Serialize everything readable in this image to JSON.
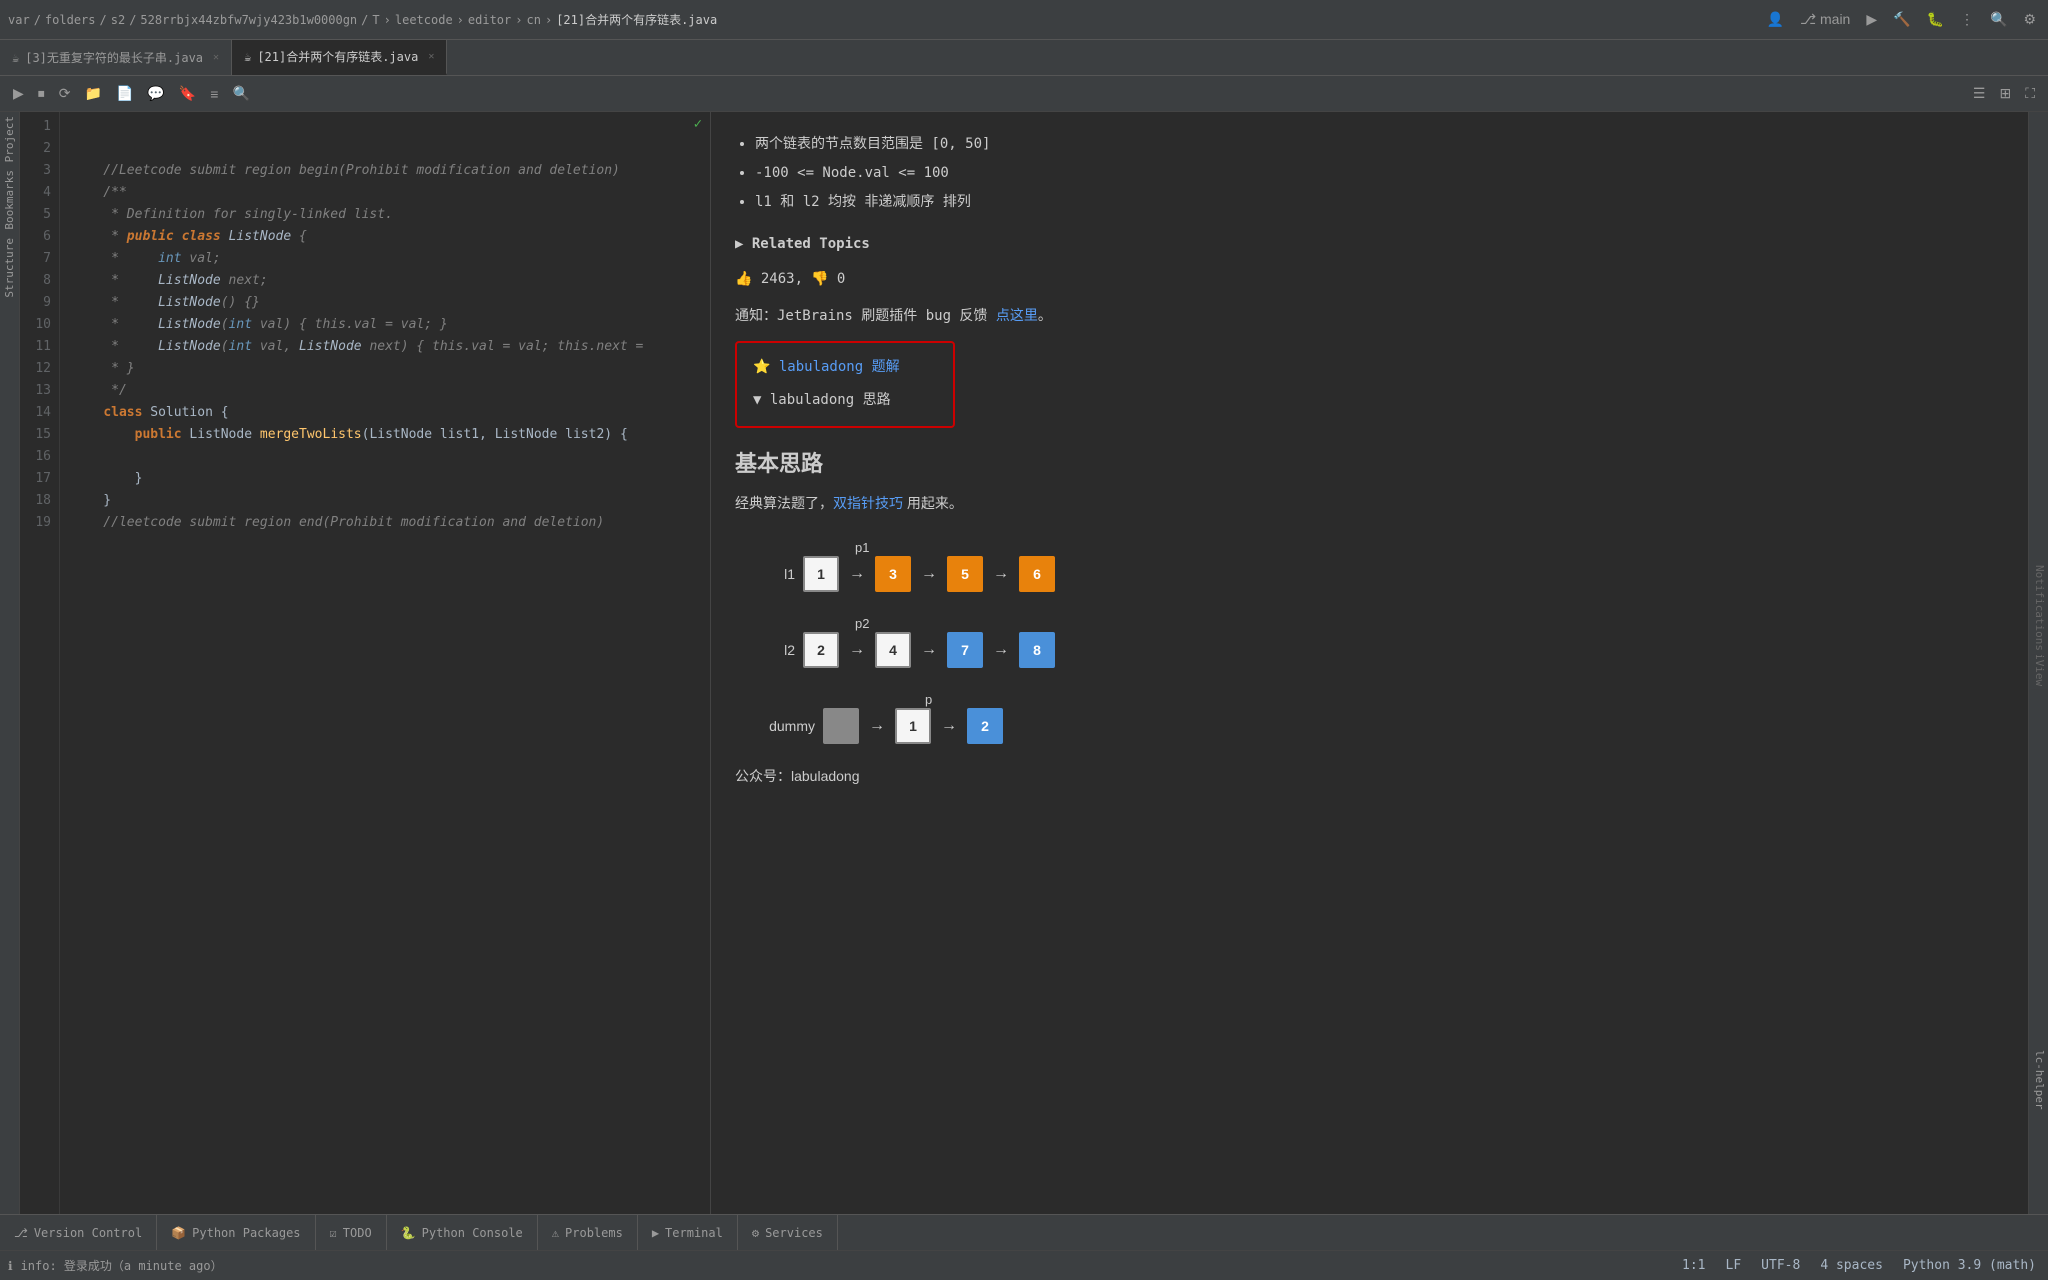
{
  "topbar": {
    "breadcrumb": [
      "var",
      "folders",
      "s2",
      "528rrbjx44zbfw7wjy423b1w0000gn",
      "T",
      "leetcode",
      "editor",
      "cn",
      "[21]合并两个有序链表.java"
    ],
    "separators": [
      "/",
      "/",
      "/",
      "/",
      ">",
      ">",
      ">",
      ">",
      ">"
    ]
  },
  "tabs": [
    {
      "label": "[3]无重复字符的最长子串.java",
      "active": false,
      "icon": "☕"
    },
    {
      "label": "[21]合并两个有序链表.java",
      "active": true,
      "icon": "☕"
    }
  ],
  "toolbar": {
    "buttons": [
      "▶",
      "⏹",
      "⟳",
      "📁",
      "📄",
      "💬",
      "⚙",
      "≡",
      "🔍"
    ]
  },
  "code": {
    "lines": [
      "",
      "    //Leetcode submit region begin(Prohibit modification and deletion)",
      "    /**",
      "     * Definition for singly-linked list.",
      "     * public class ListNode {",
      "     *     int val;",
      "     *     ListNode next;",
      "     *     ListNode() {}",
      "     *     ListNode(int val) { this.val = val; }",
      "     *     ListNode(int val, ListNode next) { this.val = val; this.next =",
      "     * }",
      "     */",
      "    class Solution {",
      "        public ListNode mergeTwoLists(ListNode list1, ListNode list2) {",
      "",
      "        }",
      "    }",
      "    //leetcode submit region end(Prohibit modification and deletion)",
      ""
    ],
    "lineNumbers": [
      1,
      2,
      3,
      4,
      5,
      6,
      7,
      8,
      9,
      10,
      11,
      12,
      13,
      14,
      15,
      16,
      17,
      18,
      19
    ]
  },
  "rightPanel": {
    "bulletPoints": [
      "两个链表的节点数目范围是  [0, 50]",
      "-100 <= Node.val <= 100",
      "l1 和 l2 均按 非递减顺序 排列"
    ],
    "relatedTopics": "▶ Related Topics",
    "thumbsUp": "👍 2463,",
    "thumbsDown": "👎 0",
    "notification": "通知：JetBrains 刷题插件 bug 反馈",
    "notificationLink": "点这里",
    "labuladongTitle": "⭐ labuladong 题解",
    "labuladongThought": "▼ labuladong 思路",
    "sectionTitle": "基本思路",
    "sectionText": "经典算法题了，",
    "sectionLink": "双指针技巧",
    "sectionTextAfter": "用起来。",
    "wechat": "公众号：labuladong",
    "diagram": {
      "l1Label": "l1",
      "l2Label": "l2",
      "dummyLabel": "dummy",
      "p1Label": "p1",
      "p2Label": "p2",
      "pLabel": "p",
      "l1Nodes": [
        {
          "val": "1",
          "type": "white"
        },
        {
          "val": "3",
          "type": "orange"
        },
        {
          "val": "5",
          "type": "orange"
        },
        {
          "val": "6",
          "type": "orange"
        }
      ],
      "l2Nodes": [
        {
          "val": "2",
          "type": "white"
        },
        {
          "val": "4",
          "type": "white"
        },
        {
          "val": "7",
          "type": "blue"
        },
        {
          "val": "8",
          "type": "blue"
        }
      ],
      "dummyNodes": [
        {
          "val": "",
          "type": "gray"
        },
        {
          "val": "1",
          "type": "white"
        },
        {
          "val": "2",
          "type": "blue"
        }
      ]
    }
  },
  "bottomTabs": [
    {
      "label": "Version Control",
      "icon": "⎇",
      "active": false
    },
    {
      "label": "Python Packages",
      "icon": "📦",
      "active": false
    },
    {
      "label": "TODO",
      "icon": "☑",
      "active": false
    },
    {
      "label": "Python Console",
      "icon": "🐍",
      "active": false
    },
    {
      "label": "Problems",
      "icon": "⚠",
      "active": false
    },
    {
      "label": "Terminal",
      "icon": "▶",
      "active": false
    },
    {
      "label": "Services",
      "icon": "⚙",
      "active": false
    }
  ],
  "statusBar": {
    "statusMsg": "登录成功（a minute ago）",
    "position": "1:1",
    "lineEnding": "LF",
    "encoding": "UTF-8",
    "indent": "4 spaces",
    "language": "Python 3.9 (math)"
  },
  "sideLabels": {
    "project": "Project",
    "bookmarks": "Bookmarks",
    "structure": "Structure",
    "scView": "SCiView",
    "notifications": "Notifications",
    "lcHelper": "lc-helper"
  },
  "runBar": {
    "icon": "ℹ",
    "text": "info: 登录成功（a minute ago）"
  }
}
